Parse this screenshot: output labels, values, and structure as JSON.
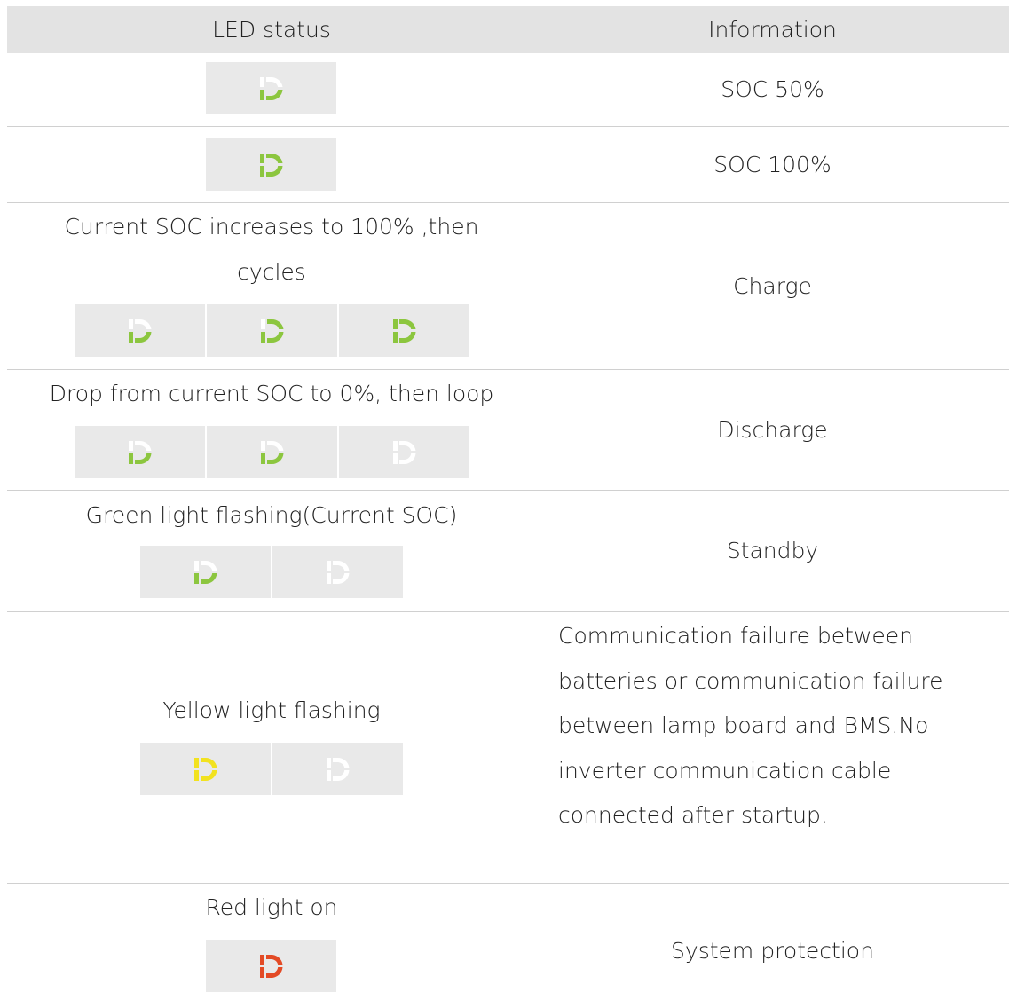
{
  "header": {
    "col1": "LED status",
    "col2": "Information"
  },
  "colors": {
    "green": "#8cc63f",
    "yellow": "#f2e21f",
    "red": "#e34a25",
    "off": "#ffffff"
  },
  "rows": [
    {
      "label": "",
      "info": "SOC 50%",
      "leds": [
        "green-half"
      ]
    },
    {
      "label": "",
      "info": "SOC 100%",
      "leds": [
        "green-full"
      ]
    },
    {
      "label_lines": [
        "Current SOC increases to 100% ,then",
        "cycles"
      ],
      "info": "Charge",
      "leds": [
        "green-half",
        "green-mostly",
        "green-full"
      ]
    },
    {
      "label": "Drop from current SOC to 0%, then loop",
      "info": "Discharge",
      "leds": [
        "green-half",
        "green-bottom",
        "off"
      ]
    },
    {
      "label": "Green light flashing(Current SOC)",
      "info": "Standby",
      "leds": [
        "green-half",
        "off"
      ]
    },
    {
      "label": "Yellow light flashing",
      "info_lines": [
        "Communication failure between",
        "batteries or communication failure",
        "between lamp board and BMS.No",
        "inverter communication cable",
        "connected after startup."
      ],
      "leds": [
        "yellow-full",
        "off"
      ]
    },
    {
      "label": "Red light on",
      "info": "System protection",
      "leds": [
        "red-full"
      ]
    }
  ]
}
